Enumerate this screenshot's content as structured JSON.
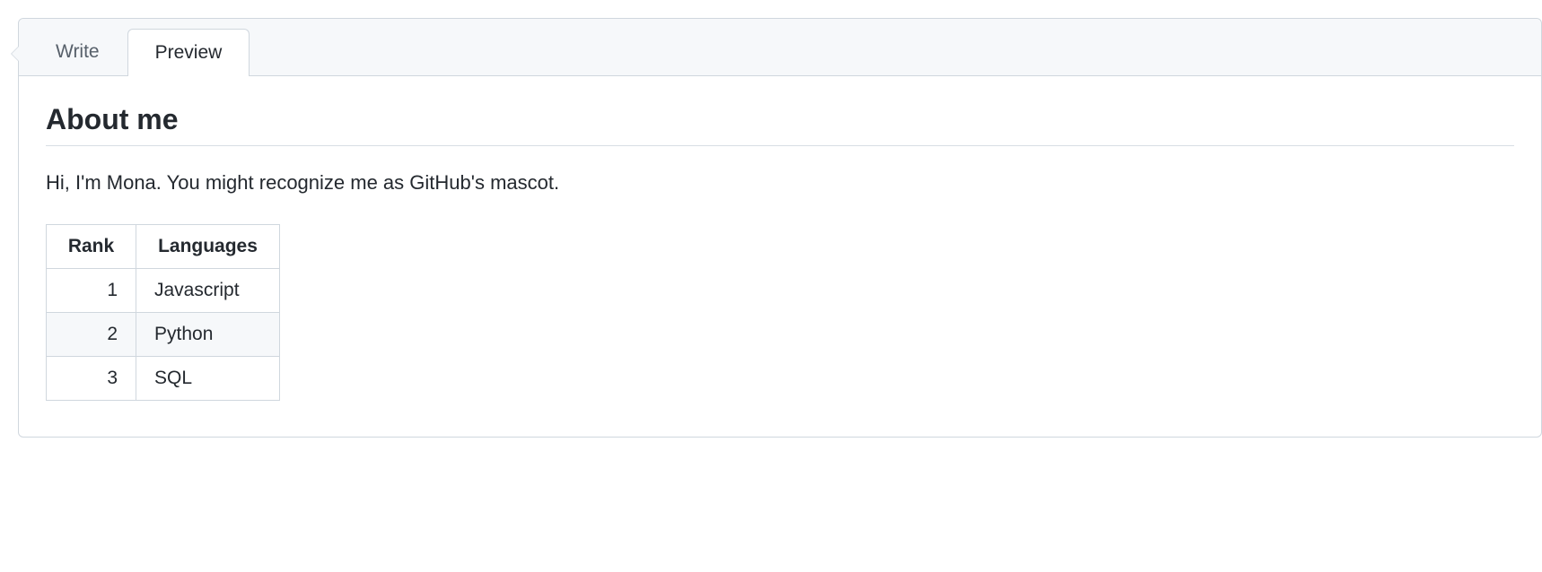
{
  "tabs": {
    "write": "Write",
    "preview": "Preview"
  },
  "content": {
    "heading": "About me",
    "intro": "Hi, I'm Mona. You might recognize me as GitHub's mascot."
  },
  "table": {
    "headers": {
      "rank": "Rank",
      "languages": "Languages"
    },
    "rows": [
      {
        "rank": "1",
        "language": "Javascript"
      },
      {
        "rank": "2",
        "language": "Python"
      },
      {
        "rank": "3",
        "language": "SQL"
      }
    ]
  }
}
